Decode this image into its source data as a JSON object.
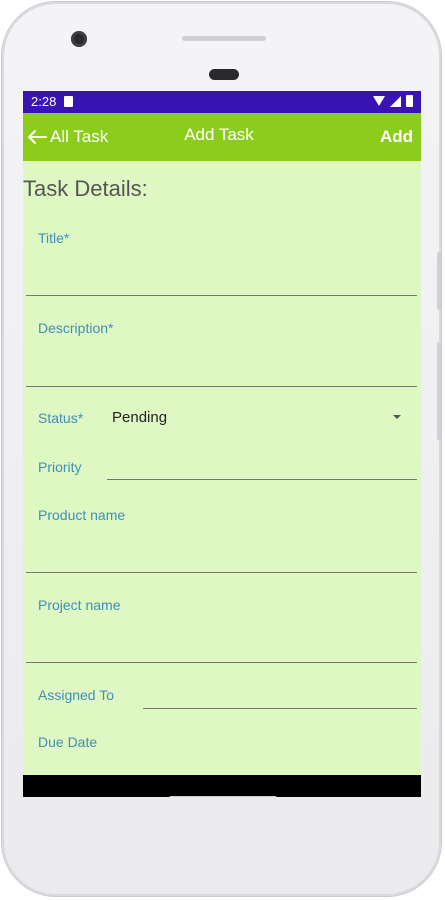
{
  "status_bar": {
    "time": "2:28"
  },
  "toolbar": {
    "back_label": "All Task",
    "title": "Add Task",
    "add_label": "Add"
  },
  "form": {
    "section_title": "Task Details:",
    "title_label": "Title*",
    "description_label": "Description*",
    "status_label": "Status*",
    "status_value": "Pending",
    "priority_label": "Priority",
    "product_label": "Product name",
    "project_label": "Project name",
    "assigned_label": "Assigned To",
    "due_label": "Due Date"
  },
  "colors": {
    "status_bar": "#3a13b5",
    "toolbar": "#8ccc1d",
    "background": "#dff7c3",
    "label": "#3f8fb6"
  }
}
